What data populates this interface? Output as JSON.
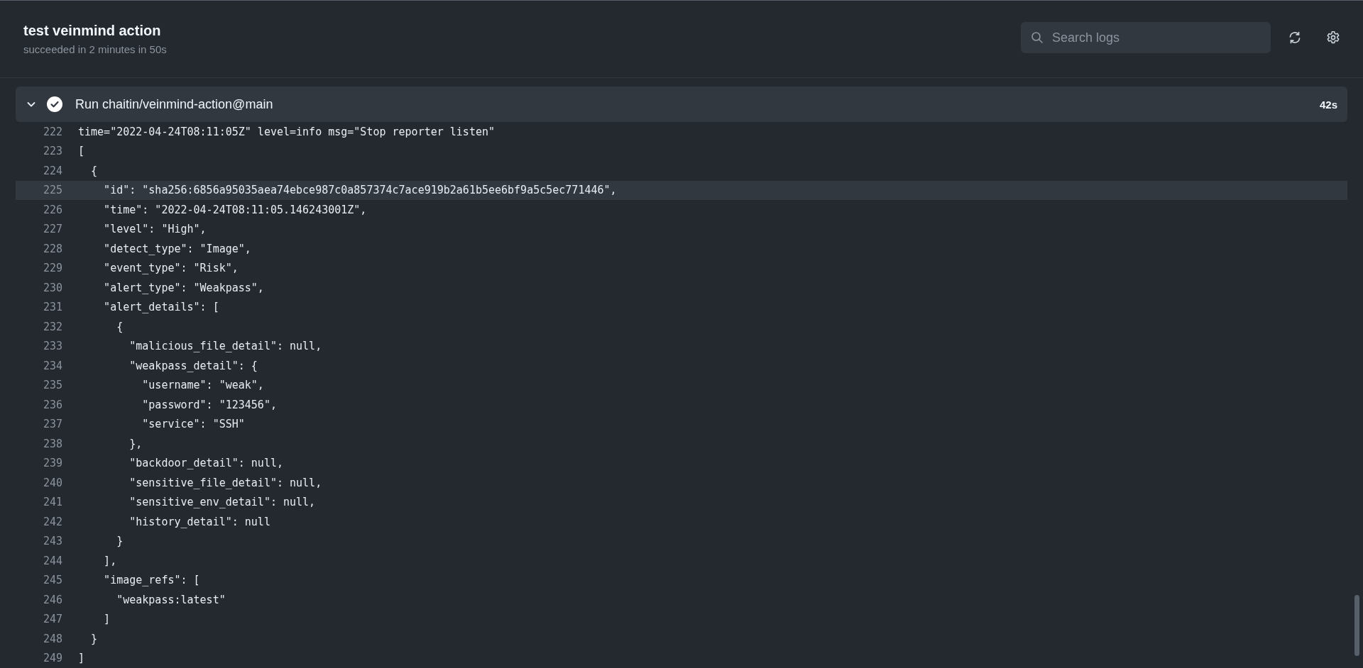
{
  "job": {
    "title": "test veinmind action",
    "summary": "succeeded in 2 minutes in 50s"
  },
  "search": {
    "placeholder": "Search logs"
  },
  "step": {
    "name": "Run chaitin/veinmind-action@main",
    "duration": "42s",
    "expanded": true,
    "succeeded": true
  },
  "log_lines": [
    {
      "number": "222",
      "text": "time=\"2022-04-24T08:11:05Z\" level=info msg=\"Stop reporter listen\"",
      "selected": false
    },
    {
      "number": "223",
      "text": "[",
      "selected": false
    },
    {
      "number": "224",
      "text": "  {",
      "selected": false
    },
    {
      "number": "225",
      "text": "    \"id\": \"sha256:6856a95035aea74ebce987c0a857374c7ace919b2a61b5ee6bf9a5c5ec771446\",",
      "selected": true
    },
    {
      "number": "226",
      "text": "    \"time\": \"2022-04-24T08:11:05.146243001Z\",",
      "selected": false
    },
    {
      "number": "227",
      "text": "    \"level\": \"High\",",
      "selected": false
    },
    {
      "number": "228",
      "text": "    \"detect_type\": \"Image\",",
      "selected": false
    },
    {
      "number": "229",
      "text": "    \"event_type\": \"Risk\",",
      "selected": false
    },
    {
      "number": "230",
      "text": "    \"alert_type\": \"Weakpass\",",
      "selected": false
    },
    {
      "number": "231",
      "text": "    \"alert_details\": [",
      "selected": false
    },
    {
      "number": "232",
      "text": "      {",
      "selected": false
    },
    {
      "number": "233",
      "text": "        \"malicious_file_detail\": null,",
      "selected": false
    },
    {
      "number": "234",
      "text": "        \"weakpass_detail\": {",
      "selected": false
    },
    {
      "number": "235",
      "text": "          \"username\": \"weak\",",
      "selected": false
    },
    {
      "number": "236",
      "text": "          \"password\": \"123456\",",
      "selected": false
    },
    {
      "number": "237",
      "text": "          \"service\": \"SSH\"",
      "selected": false
    },
    {
      "number": "238",
      "text": "        },",
      "selected": false
    },
    {
      "number": "239",
      "text": "        \"backdoor_detail\": null,",
      "selected": false
    },
    {
      "number": "240",
      "text": "        \"sensitive_file_detail\": null,",
      "selected": false
    },
    {
      "number": "241",
      "text": "        \"sensitive_env_detail\": null,",
      "selected": false
    },
    {
      "number": "242",
      "text": "        \"history_detail\": null",
      "selected": false
    },
    {
      "number": "243",
      "text": "      }",
      "selected": false
    },
    {
      "number": "244",
      "text": "    ],",
      "selected": false
    },
    {
      "number": "245",
      "text": "    \"image_refs\": [",
      "selected": false
    },
    {
      "number": "246",
      "text": "      \"weakpass:latest\"",
      "selected": false
    },
    {
      "number": "247",
      "text": "    ]",
      "selected": false
    },
    {
      "number": "248",
      "text": "  }",
      "selected": false
    },
    {
      "number": "249",
      "text": "]",
      "selected": false
    }
  ]
}
